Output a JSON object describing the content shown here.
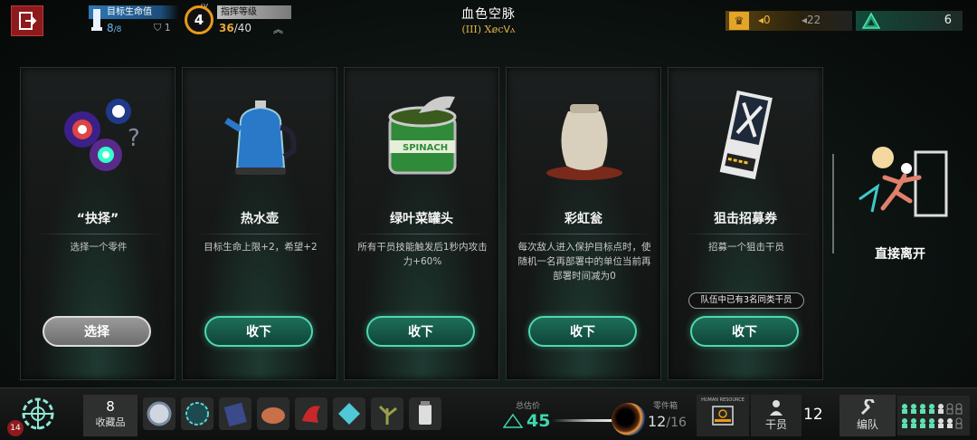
{
  "top_bar": {
    "exit_icon": "exit-door-icon",
    "hp_label": "目标生命值",
    "hp_current": "8",
    "hp_max": "/8",
    "shield_value": "1",
    "level": "4",
    "level_tag": "LV",
    "command_label": "指挥等级",
    "command_current": "36",
    "command_max": "/40",
    "stage_title": "血色空脉",
    "stage_subtitle": "(III) Ⅹⅇϲⴸⲁ",
    "ingot_value": "◂0",
    "ingot_value2": "◂22",
    "hope_value": "6",
    "colors": {
      "accent_green": "#4fd8b0",
      "gold": "#e2a52a",
      "exit_red": "#8e1a1d"
    }
  },
  "cards": [
    {
      "name": "“抉择”",
      "desc": "选择一个零件",
      "warn": "",
      "button": "选择",
      "button_style": "grey",
      "art_icon": "swirling-orbs-icon"
    },
    {
      "name": "热水壶",
      "desc": "目标生命上限+2，希望+2",
      "warn": "",
      "button": "收下",
      "button_style": "green",
      "art_icon": "kettle-icon"
    },
    {
      "name": "绿叶菜罐头",
      "desc": "所有干员技能触发后1秒内攻击力+60%",
      "warn": "",
      "button": "收下",
      "button_style": "green",
      "art_icon": "spinach-can-icon"
    },
    {
      "name": "彩虹瓮",
      "desc": "每次敌人进入保护目标点时，使随机一名再部署中的单位当前再部署时间减为0",
      "warn": "",
      "button": "收下",
      "button_style": "green",
      "art_icon": "clay-urn-icon"
    },
    {
      "name": "狙击招募券",
      "desc": "招募一个狙击干员",
      "warn": "队伍中已有3名同类干员",
      "button": "收下",
      "button_style": "green",
      "art_icon": "recruit-ticket-icon"
    }
  ],
  "leave": {
    "label": "直接离开",
    "icon": "running-figure-icon"
  },
  "bottom_bar": {
    "emblem_level": "14",
    "collection_count": "8",
    "collection_label": "收藏品",
    "total_label": "总估价",
    "total_value": "45",
    "parts_label": "零件箱",
    "parts_current": "12",
    "parts_max": "/16",
    "hr_label": "HUMAN RESOURCE",
    "staff_label": "干员",
    "staff_count": "12",
    "team_label": "编队"
  }
}
